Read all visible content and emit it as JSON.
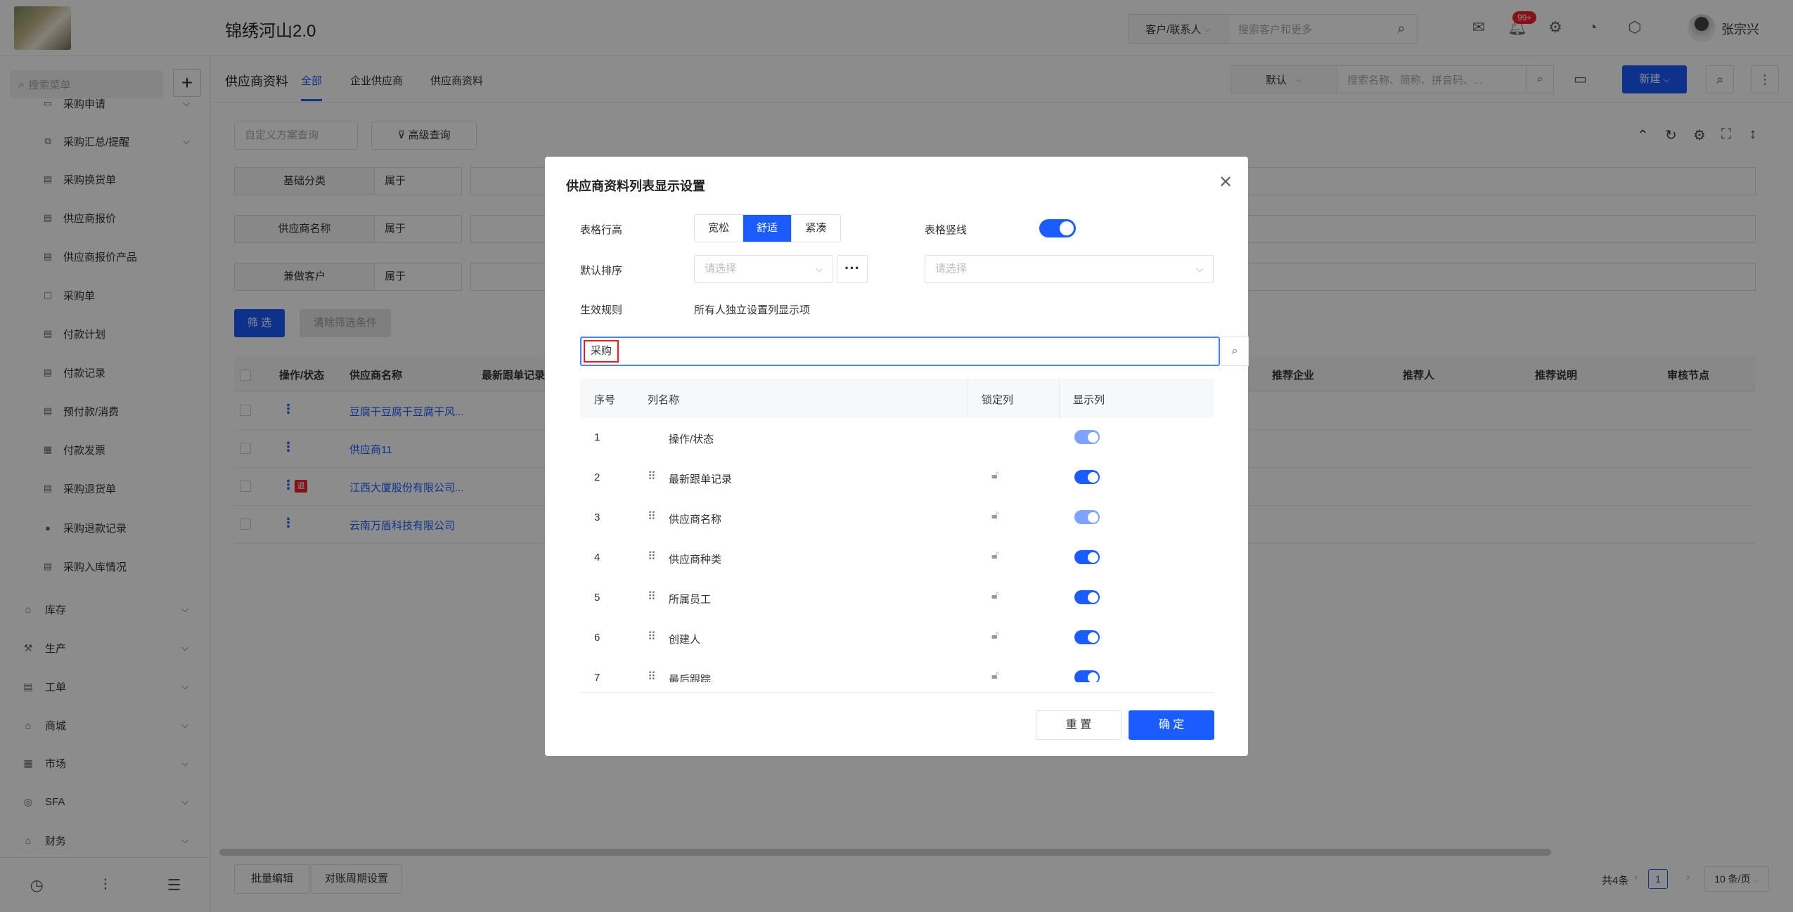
{
  "header": {
    "app_title": "锦绣河山2.0",
    "search_type": "客户/联系人",
    "search_placeholder": "搜索客户和更多",
    "notif_count": "99+",
    "user_name": "张宗兴"
  },
  "sidebar": {
    "search_placeholder": "搜索菜单",
    "sub_items": [
      "采购申请",
      "采购汇总/提醒",
      "采购换货单",
      "供应商报价",
      "供应商报价产品",
      "采购单",
      "付款计划",
      "付款记录",
      "预付款/消费",
      "付款发票",
      "采购退货单",
      "采购退款记录",
      "采购入库情况"
    ],
    "groups": [
      "库存",
      "生产",
      "工单",
      "商城",
      "市场",
      "SFA",
      "财务"
    ]
  },
  "subheader": {
    "page_name": "供应商资料",
    "tabs": [
      "全部",
      "企业供应商",
      "供应商资料"
    ],
    "select_value": "默认",
    "search_placeholder": "搜索名称、简称、拼音码、...",
    "new_label": "新建"
  },
  "filters": {
    "custom_placeholder": "自定义方案查询",
    "advanced_label": "高级查询",
    "rows": [
      {
        "label": "基础分类",
        "op": "属于"
      },
      {
        "label": "供应商名称",
        "op": "属于"
      },
      {
        "label": "兼做客户",
        "op": "属于"
      }
    ],
    "filter_label": "筛 选",
    "clear_label": "清除筛选条件"
  },
  "table": {
    "headers": [
      "操作/状态",
      "供应商名称",
      "最新跟单记录",
      "推荐企业",
      "推荐人",
      "推荐说明",
      "审核节点"
    ],
    "rows": [
      {
        "name": "豆腐干豆腐干豆腐干风...",
        "tag": ""
      },
      {
        "name": "供应商11",
        "tag": ""
      },
      {
        "name": "江西大厦股份有限公司...",
        "tag": "退"
      },
      {
        "name": "云南万盾科技有限公司",
        "tag": ""
      }
    ]
  },
  "footer": {
    "batch_edit": "批量编辑",
    "period_settings": "对账周期设置",
    "total": "共4条",
    "page": "1",
    "page_size": "10 条/页"
  },
  "modal": {
    "title": "供应商资料列表显示设置",
    "row_height_label": "表格行高",
    "row_height_options": [
      "宽松",
      "舒适",
      "紧凑"
    ],
    "row_height_selected": "舒适",
    "vertical_lines_label": "表格竖线",
    "default_sort_label": "默认排序",
    "sort_placeholder_1": "请选择",
    "sort_placeholder_2": "请选择",
    "rule_label": "生效规则",
    "rule_value": "所有人独立设置列显示项",
    "search_value": "采购",
    "col_headers": [
      "序号",
      "列名称",
      "锁定列",
      "显示列"
    ],
    "columns": [
      {
        "idx": "1",
        "name": "操作/状态",
        "lockable": false,
        "dim": true
      },
      {
        "idx": "2",
        "name": "最新跟单记录",
        "lockable": true,
        "dim": false
      },
      {
        "idx": "3",
        "name": "供应商名称",
        "lockable": true,
        "dim": true
      },
      {
        "idx": "4",
        "name": "供应商种类",
        "lockable": true,
        "dim": false
      },
      {
        "idx": "5",
        "name": "所属员工",
        "lockable": true,
        "dim": false
      },
      {
        "idx": "6",
        "name": "创建人",
        "lockable": true,
        "dim": false
      },
      {
        "idx": "7",
        "name": "最后跟踪",
        "lockable": true,
        "dim": false
      }
    ],
    "reset_label": "重 置",
    "ok_label": "确 定"
  },
  "colors": {
    "accent": "#1a5cff",
    "danger": "#f5222d"
  }
}
